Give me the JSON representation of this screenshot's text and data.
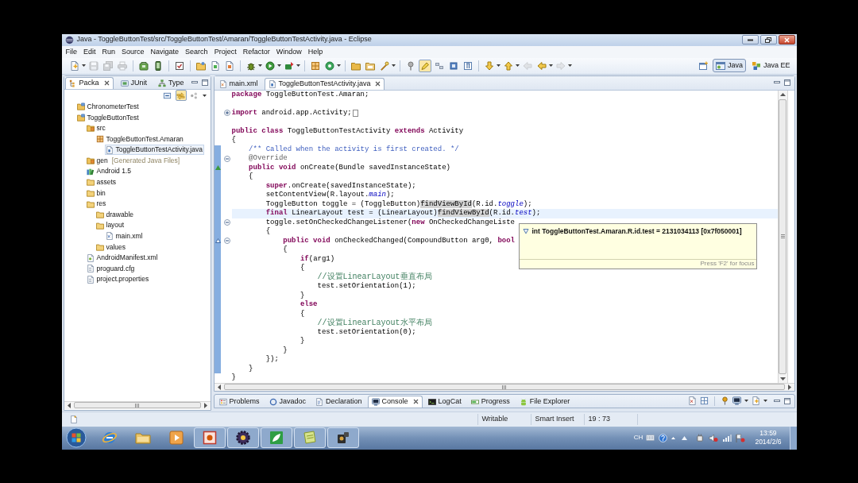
{
  "window": {
    "title": "Java - ToggleButtonTest/src/ToggleButtonTest/Amaran/ToggleButtonTestActivity.java - Eclipse"
  },
  "menu_bar": [
    "File",
    "Edit",
    "Run",
    "Source",
    "Navigate",
    "Search",
    "Project",
    "Refactor",
    "Window",
    "Help"
  ],
  "toolbar": [
    [
      {
        "kind": "new",
        "disabled": false
      },
      {
        "kind": "save",
        "disabled": true
      },
      {
        "kind": "save-all",
        "disabled": true
      },
      {
        "kind": "print",
        "disabled": true
      }
    ],
    [
      {
        "kind": "sdk",
        "disabled": false
      },
      {
        "kind": "avd",
        "disabled": false
      }
    ],
    [
      {
        "kind": "lint",
        "disabled": false
      }
    ],
    [
      {
        "kind": "new-project",
        "disabled": false
      },
      {
        "kind": "new-junit",
        "disabled": false
      },
      {
        "kind": "new-xml",
        "disabled": false
      }
    ],
    [
      {
        "kind": "debug",
        "disabled": false
      },
      {
        "kind": "run",
        "disabled": false
      },
      {
        "kind": "external",
        "disabled": false
      }
    ],
    [
      {
        "kind": "new-package",
        "disabled": false
      },
      {
        "kind": "new-class",
        "disabled": false
      }
    ],
    [
      {
        "kind": "open-type",
        "disabled": false
      },
      {
        "kind": "open-task",
        "disabled": false
      },
      {
        "kind": "search",
        "disabled": false
      }
    ],
    [
      {
        "kind": "pin",
        "disabled": false,
        "pressed": false
      },
      {
        "kind": "occurrences",
        "disabled": false,
        "pressed": true
      },
      {
        "kind": "block",
        "disabled": false,
        "pressed": false
      },
      {
        "kind": "whitespace",
        "disabled": false,
        "pressed": false
      },
      {
        "kind": "pilcrow",
        "disabled": false,
        "pressed": false
      }
    ],
    [
      {
        "kind": "next-annotation",
        "disabled": false
      },
      {
        "kind": "prev-annotation",
        "disabled": false
      },
      {
        "kind": "last-edit",
        "disabled": true
      },
      {
        "kind": "back",
        "disabled": false
      },
      {
        "kind": "forward",
        "disabled": true
      }
    ]
  ],
  "perspectives": [
    {
      "label": "Java",
      "selected": true
    },
    {
      "label": "Java EE",
      "selected": false
    }
  ],
  "package_explorer": {
    "tabs": [
      {
        "label": "Packa",
        "kind": "explorer",
        "selected": true
      },
      {
        "label": "JUnit",
        "kind": "junit",
        "selected": false
      },
      {
        "label": "Type",
        "kind": "type",
        "selected": false
      }
    ],
    "toolbar": [
      {
        "kind": "collapse",
        "pressed": false
      },
      {
        "kind": "link",
        "pressed": true
      },
      {
        "kind": "focus",
        "pressed": false
      }
    ],
    "tree": [
      {
        "label": "ChronometerTest",
        "kind": "project",
        "selected": false
      },
      {
        "label": "ToggleButtonTest",
        "kind": "project",
        "selected": false,
        "children": [
          {
            "label": "src",
            "kind": "source-folder",
            "selected": false,
            "children": [
              {
                "label": "ToggleButtonTest.Amaran",
                "kind": "package",
                "selected": false,
                "children": [
                  {
                    "label": "ToggleButtonTestActivity.java",
                    "kind": "java-file",
                    "selected": true
                  }
                ]
              }
            ]
          },
          {
            "label": "gen",
            "note": "[Generated Java Files]",
            "kind": "source-folder",
            "selected": false
          },
          {
            "label": "Android 1.5",
            "kind": "library",
            "selected": false
          },
          {
            "label": "assets",
            "kind": "folder",
            "selected": false
          },
          {
            "label": "bin",
            "kind": "folder",
            "selected": false
          },
          {
            "label": "res",
            "kind": "folder",
            "selected": false,
            "children": [
              {
                "label": "drawable",
                "kind": "folder",
                "selected": false
              },
              {
                "label": "layout",
                "kind": "folder",
                "selected": false,
                "children": [
                  {
                    "label": "main.xml",
                    "kind": "xml-file",
                    "selected": false
                  }
                ]
              },
              {
                "label": "values",
                "kind": "folder",
                "selected": false
              }
            ]
          },
          {
            "label": "AndroidManifest.xml",
            "kind": "manifest",
            "selected": false
          },
          {
            "label": "proguard.cfg",
            "kind": "file",
            "selected": false
          },
          {
            "label": "project.properties",
            "kind": "file",
            "selected": false
          }
        ]
      }
    ]
  },
  "editor": {
    "tabs": [
      {
        "label": "main.xml",
        "kind": "xml",
        "selected": false
      },
      {
        "label": "ToggleButtonTestActivity.java",
        "kind": "java",
        "selected": true
      }
    ],
    "lines": [
      {
        "segments": [
          {
            "kind": "keyword",
            "text": "package"
          },
          {
            "kind": "plain",
            "text": " ToggleButtonTest.Amaran;"
          }
        ],
        "current": false,
        "in_range": false
      },
      {
        "current": false,
        "in_range": false
      },
      {
        "segments": [
          {
            "kind": "keyword",
            "text": "import"
          },
          {
            "kind": "plain",
            "text": " android.app.Activity;"
          }
        ],
        "collapsed": true,
        "current": false,
        "in_range": false
      },
      {
        "current": false,
        "in_range": false
      },
      {
        "segments": [
          {
            "kind": "keyword",
            "text": "public class"
          },
          {
            "kind": "plain",
            "text": " ToggleButtonTestActivity "
          },
          {
            "kind": "keyword",
            "text": "extends"
          },
          {
            "kind": "plain",
            "text": " Activity"
          }
        ],
        "current": false,
        "in_range": false
      },
      {
        "segments": [
          {
            "kind": "plain",
            "text": "{"
          }
        ],
        "current": false,
        "in_range": false
      },
      {
        "segments": [
          {
            "kind": "javadoc",
            "text": "    /** Called when the activity is first created. */"
          }
        ],
        "current": false,
        "in_range": true
      },
      {
        "segments": [
          {
            "kind": "annotation",
            "text": "    @Override"
          }
        ],
        "collapsed": false,
        "current": false,
        "in_range": true
      },
      {
        "segments": [
          {
            "kind": "keyword",
            "text": "    public void"
          },
          {
            "kind": "plain",
            "text": " onCreate(Bundle savedInstanceState)"
          }
        ],
        "overrides": true,
        "current": false,
        "in_range": true
      },
      {
        "segments": [
          {
            "kind": "plain",
            "text": "    {"
          }
        ],
        "current": false,
        "in_range": true
      },
      {
        "segments": [
          {
            "kind": "keyword",
            "text": "        super"
          },
          {
            "kind": "plain",
            "text": ".onCreate(savedInstanceState);"
          }
        ],
        "current": false,
        "in_range": true
      },
      {
        "segments": [
          {
            "kind": "plain",
            "text": "        setContentView(R.layout."
          },
          {
            "kind": "field",
            "text": "main"
          },
          {
            "kind": "plain",
            "text": ");"
          }
        ],
        "current": false,
        "in_range": true
      },
      {
        "segments": [
          {
            "kind": "plain",
            "text": "        ToggleButton toggle = (ToggleButton)"
          },
          {
            "kind": "occurrence",
            "text": "findViewById"
          },
          {
            "kind": "plain",
            "text": "(R.id."
          },
          {
            "kind": "field",
            "text": "toggle"
          },
          {
            "kind": "plain",
            "text": ");"
          }
        ],
        "current": false,
        "in_range": true
      },
      {
        "segments": [
          {
            "kind": "keyword",
            "text": "        final"
          },
          {
            "kind": "plain",
            "text": " LinearLayout test = (LinearLayout)"
          },
          {
            "kind": "occurrence",
            "text": "findViewById"
          },
          {
            "kind": "plain",
            "text": "(R.id."
          },
          {
            "kind": "field",
            "text": "test"
          },
          {
            "kind": "plain",
            "text": ");"
          }
        ],
        "current": true,
        "in_range": true
      },
      {
        "segments": [
          {
            "kind": "plain",
            "text": "        toggle.setOnCheckedChangeListener("
          },
          {
            "kind": "keyword",
            "text": "new"
          },
          {
            "kind": "plain",
            "text": " OnCheckedChangeListe"
          }
        ],
        "collapsed": false,
        "current": false,
        "in_range": true
      },
      {
        "segments": [
          {
            "kind": "plain",
            "text": "        {"
          }
        ],
        "current": false,
        "in_range": true
      },
      {
        "segments": [
          {
            "kind": "keyword",
            "text": "            public void"
          },
          {
            "kind": "plain",
            "text": " onCheckedChanged(CompoundButton arg0, "
          },
          {
            "kind": "keyword",
            "text": "bool"
          }
        ],
        "collapsed": false,
        "implements": true,
        "current": false,
        "in_range": true
      },
      {
        "segments": [
          {
            "kind": "plain",
            "text": "            {"
          }
        ],
        "current": false,
        "in_range": true
      },
      {
        "segments": [
          {
            "kind": "keyword",
            "text": "                if"
          },
          {
            "kind": "plain",
            "text": "(arg1)"
          }
        ],
        "current": false,
        "in_range": true
      },
      {
        "segments": [
          {
            "kind": "plain",
            "text": "                {"
          }
        ],
        "current": false,
        "in_range": true
      },
      {
        "segments": [
          {
            "kind": "comment",
            "text": "                    //设置LinearLayout垂直布局"
          }
        ],
        "current": false,
        "in_range": true
      },
      {
        "segments": [
          {
            "kind": "plain",
            "text": "                    test.setOrientation(1);"
          }
        ],
        "current": false,
        "in_range": true
      },
      {
        "segments": [
          {
            "kind": "plain",
            "text": "                }"
          }
        ],
        "current": false,
        "in_range": true
      },
      {
        "segments": [
          {
            "kind": "keyword",
            "text": "                else"
          }
        ],
        "current": false,
        "in_range": true
      },
      {
        "segments": [
          {
            "kind": "plain",
            "text": "                {"
          }
        ],
        "current": false,
        "in_range": true
      },
      {
        "segments": [
          {
            "kind": "comment",
            "text": "                    //设置LinearLayout水平布局"
          }
        ],
        "current": false,
        "in_range": true
      },
      {
        "segments": [
          {
            "kind": "plain",
            "text": "                    test.setOrientation(0);"
          }
        ],
        "current": false,
        "in_range": true
      },
      {
        "segments": [
          {
            "kind": "plain",
            "text": "                }"
          }
        ],
        "current": false,
        "in_range": true
      },
      {
        "segments": [
          {
            "kind": "plain",
            "text": "            }"
          }
        ],
        "current": false,
        "in_range": true
      },
      {
        "segments": [
          {
            "kind": "plain",
            "text": "        });"
          }
        ],
        "current": false,
        "in_range": true
      },
      {
        "segments": [
          {
            "kind": "plain",
            "text": "    }"
          }
        ],
        "current": false,
        "in_range": true
      },
      {
        "segments": [
          {
            "kind": "plain",
            "text": "}"
          }
        ],
        "current": false,
        "in_range": false
      }
    ],
    "tooltip": {
      "text": "int ToggleButtonTest.Amaran.R.id.test = 2131034113 [0x7f050001]",
      "hint": "Press 'F2' for focus"
    }
  },
  "bottom_panel": {
    "tabs": [
      {
        "label": "Problems",
        "kind": "problems",
        "selected": false
      },
      {
        "label": "Javadoc",
        "kind": "javadoc",
        "selected": false
      },
      {
        "label": "Declaration",
        "kind": "declaration",
        "selected": false
      },
      {
        "label": "Console",
        "kind": "console",
        "selected": true
      },
      {
        "label": "LogCat",
        "kind": "logcat",
        "selected": false
      },
      {
        "label": "Progress",
        "kind": "progress",
        "selected": false
      },
      {
        "label": "File Explorer",
        "kind": "file-explorer",
        "selected": false
      }
    ]
  },
  "status_bar": {
    "fields": [
      "Writable",
      "Smart Insert",
      "19 : 73"
    ]
  },
  "taskbar": {
    "apps": [
      {
        "kind": "browser",
        "running": false
      },
      {
        "kind": "folder",
        "running": false
      },
      {
        "kind": "media",
        "running": false
      },
      {
        "kind": "slides",
        "running": true
      },
      {
        "kind": "gear",
        "running": true
      },
      {
        "kind": "leaf",
        "running": true
      },
      {
        "kind": "note",
        "running": true
      },
      {
        "kind": "camera",
        "running": true
      }
    ],
    "tray": {
      "language": "CH",
      "time": "13:59",
      "date": "2014/2/6"
    }
  }
}
